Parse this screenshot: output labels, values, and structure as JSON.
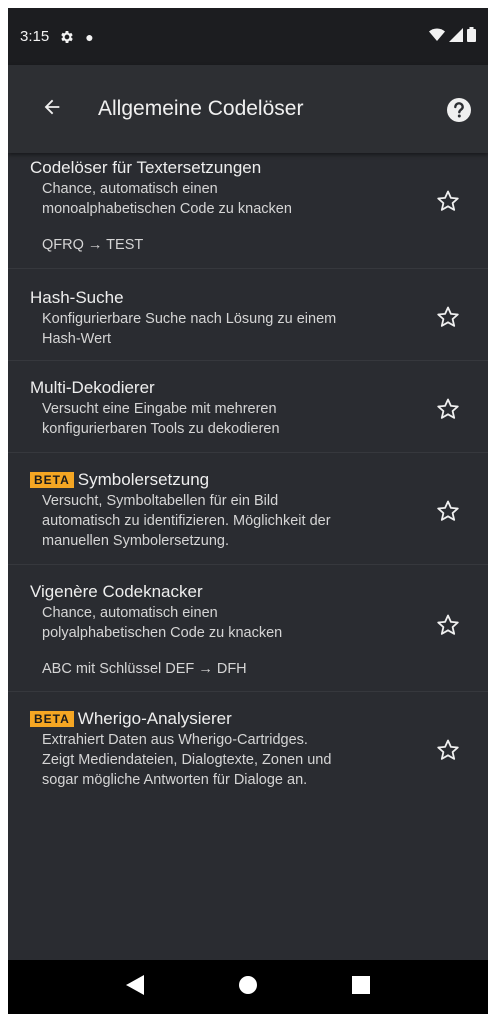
{
  "status_bar": {
    "time": "3:15",
    "icons": [
      "gear-icon",
      "notification-dot",
      "wifi-icon",
      "cell-signal-icon",
      "battery-icon"
    ]
  },
  "app_bar": {
    "title": "Allgemeine Codelöser",
    "back_icon": "arrow-left-icon",
    "help_icon": "help-circle-icon"
  },
  "items": [
    {
      "title": "Codelöser für Textersetzungen",
      "beta": false,
      "description": [
        "Chance, automatisch einen",
        "monoalphabetischen Code zu knacken"
      ],
      "example": "QFRQ → TEST",
      "favorite": false
    },
    {
      "title": "Hash-Suche",
      "beta": false,
      "description": [
        "Konfigurierbare Suche nach Lösung zu einem",
        "Hash-Wert"
      ],
      "example": "",
      "favorite": false
    },
    {
      "title": "Multi-Dekodierer",
      "beta": false,
      "description": [
        "Versucht eine Eingabe mit mehreren",
        "konfigurierbaren Tools zu dekodieren"
      ],
      "example": "",
      "favorite": false
    },
    {
      "title": "Symbolersetzung",
      "beta": true,
      "beta_label": "BETA",
      "description": [
        "Versucht, Symboltabellen für ein Bild",
        "automatisch zu identifizieren. Möglichkeit der",
        "manuellen Symbolersetzung."
      ],
      "example": "",
      "favorite": false
    },
    {
      "title": "Vigenère Codeknacker",
      "beta": false,
      "description": [
        "Chance, automatisch einen",
        "polyalphabetischen Code zu knacken"
      ],
      "example": "ABC mit Schlüssel DEF → DFH",
      "favorite": false
    },
    {
      "title": "Wherigo-Analysierer",
      "beta": true,
      "beta_label": "BETA",
      "description": [
        "Extrahiert Daten aus Wherigo-Cartridges.",
        "Zeigt Mediendateien, Dialogtexte, Zonen und",
        "sogar mögliche Antworten für Dialoge an."
      ],
      "example": "",
      "favorite": false
    }
  ],
  "nav_bar": {
    "icons": [
      "back-triangle-icon",
      "home-circle-icon",
      "recents-square-icon"
    ]
  },
  "colors": {
    "background": "#2a2c31",
    "status_bar": "#1c1d20",
    "app_bar": "#2d2f33",
    "beta_badge": "#f5a623",
    "nav_bar": "#000000"
  }
}
